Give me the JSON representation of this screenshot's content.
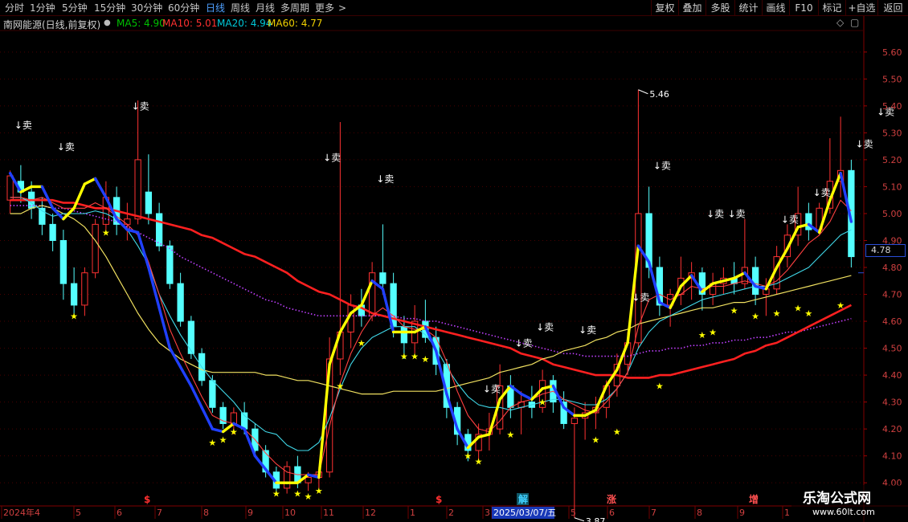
{
  "toolbar": {
    "periods": [
      "分时",
      "1分钟",
      "5分钟",
      "15分钟",
      "30分钟",
      "60分钟",
      "日线",
      "周线",
      "月线",
      "多周期",
      "更多"
    ],
    "active_period": "日线",
    "more_arrow": ">",
    "tools": [
      "复权",
      "叠加",
      "多股",
      "统计",
      "画线",
      "F10",
      "标记",
      "+自选",
      "返回"
    ]
  },
  "info": {
    "stock": "南网能源",
    "mode": "(日线,前复权)",
    "ma": [
      {
        "label": "MA5: 4.90",
        "color": "#00c000"
      },
      {
        "label": "MA10: 5.01",
        "color": "#ff3030"
      },
      {
        "label": "MA20: 4.94",
        "color": "#00c8d8"
      },
      {
        "label": "MA60: 4.77",
        "color": "#f0d000"
      }
    ]
  },
  "current_price": "4.78",
  "watermark": {
    "title": "乐淘公式网",
    "url": "www.60lt.com"
  },
  "chart_data": {
    "type": "candlestick",
    "y_axis": {
      "range": [
        3.92,
        5.68
      ],
      "ticks": [
        "5.60",
        "5.50",
        "5.40",
        "5.30",
        "5.20",
        "5.10",
        "5.00",
        "4.90",
        "4.80",
        "4.70",
        "4.60",
        "4.50",
        "4.40",
        "4.30",
        "4.20",
        "4.10",
        "4.00"
      ]
    },
    "x_axis": {
      "labels": [
        "2024年4",
        "5",
        "6",
        "7",
        "8",
        "9",
        "10",
        "11",
        "12",
        "1",
        "2",
        "3",
        "2025/03/07/五",
        "5",
        "6",
        "7",
        "8",
        "9",
        "1"
      ],
      "highlight_label": "2025/03/07/五",
      "event_marks": [
        {
          "text": "$",
          "color": "#ff3030"
        },
        {
          "text": "$",
          "color": "#ff3030"
        },
        {
          "text": "解",
          "color": "#40d0ff"
        },
        {
          "text": "涨",
          "color": "#ff5050"
        },
        {
          "text": "增",
          "color": "#ff5050"
        }
      ]
    },
    "annotations": {
      "high": "5.46",
      "low": "3.87",
      "sell_label": "↓卖",
      "star": "★"
    },
    "series": [
      {
        "name": "MA5",
        "color": "#00c000"
      },
      {
        "name": "MA10",
        "color": "#ff3030"
      },
      {
        "name": "MA20",
        "color": "#00c8d8"
      },
      {
        "name": "MA60",
        "color": "#f0d000"
      }
    ],
    "bias_line": [
      5.15,
      5.08,
      5.1,
      5.1,
      5.02,
      4.98,
      5.02,
      5.11,
      5.13,
      5.06,
      4.98,
      4.94,
      4.93,
      4.8,
      4.65,
      4.5,
      4.43,
      4.36,
      4.28,
      4.2,
      4.19,
      4.22,
      4.2,
      4.1,
      4.05,
      4.0,
      4.0,
      4.0,
      4.03,
      4.02,
      4.44,
      4.56,
      4.63,
      4.66,
      4.75,
      4.72,
      4.56,
      4.56,
      4.56,
      4.58,
      4.49,
      4.33,
      4.2,
      4.13,
      4.17,
      4.18,
      4.31,
      4.36,
      4.33,
      4.31,
      4.35,
      4.36,
      4.28,
      4.25,
      4.25,
      4.27,
      4.36,
      4.42,
      4.52,
      4.88,
      4.82,
      4.67,
      4.65,
      4.73,
      4.77,
      4.71,
      4.74,
      4.75,
      4.76,
      4.78,
      4.73,
      4.72,
      4.8,
      4.87,
      4.95,
      4.96,
      4.93,
      5.05,
      5.15,
      4.97
    ],
    "ma10_line": [
      5.06,
      5.06,
      5.05,
      5.06,
      5.04,
      5.02,
      5.02,
      5.02,
      5.04,
      5.02,
      4.99,
      4.96,
      4.92,
      4.82,
      4.7,
      4.57,
      4.48,
      4.4,
      4.32,
      4.25,
      4.23,
      4.22,
      4.2,
      4.16,
      4.11,
      4.07,
      4.04,
      4.03,
      4.03,
      4.03,
      4.21,
      4.37,
      4.48,
      4.56,
      4.62,
      4.65,
      4.62,
      4.58,
      4.57,
      4.57,
      4.54,
      4.45,
      4.34,
      4.25,
      4.2,
      4.19,
      4.23,
      4.28,
      4.3,
      4.31,
      4.33,
      4.34,
      4.31,
      4.29,
      4.27,
      4.26,
      4.3,
      4.35,
      4.41,
      4.58,
      4.68,
      4.7,
      4.68,
      4.7,
      4.73,
      4.72,
      4.73,
      4.73,
      4.74,
      4.75,
      4.74,
      4.73,
      4.75,
      4.79,
      4.84,
      4.89,
      4.92,
      4.97,
      5.05,
      5.01
    ],
    "ma20_line": [
      5.06,
      5.06,
      5.04,
      5.01,
      4.99,
      5.0,
      5.0,
      5.0,
      5.01,
      5.0,
      4.98,
      4.94,
      4.88,
      4.81,
      4.7,
      4.62,
      4.55,
      4.49,
      4.43,
      4.38,
      4.34,
      4.3,
      4.25,
      4.22,
      4.19,
      4.18,
      4.14,
      4.12,
      4.12,
      4.15,
      4.24,
      4.35,
      4.44,
      4.5,
      4.54,
      4.56,
      4.58,
      4.58,
      4.58,
      4.55,
      4.5,
      4.43,
      4.37,
      4.32,
      4.29,
      4.28,
      4.28,
      4.27,
      4.28,
      4.29,
      4.3,
      4.31,
      4.31,
      4.3,
      4.29,
      4.29,
      4.31,
      4.35,
      4.41,
      4.5,
      4.56,
      4.6,
      4.62,
      4.64,
      4.66,
      4.68,
      4.69,
      4.7,
      4.71,
      4.72,
      4.73,
      4.73,
      4.74,
      4.76,
      4.78,
      4.8,
      4.84,
      4.88,
      4.92,
      4.94
    ],
    "ma60_line": [
      5.0,
      5.0,
      5.02,
      5.03,
      5.02,
      5.0,
      4.98,
      4.95,
      4.9,
      4.84,
      4.77,
      4.7,
      4.63,
      4.57,
      4.52,
      4.49,
      4.46,
      4.44,
      4.42,
      4.41,
      4.41,
      4.41,
      4.41,
      4.41,
      4.4,
      4.4,
      4.39,
      4.38,
      4.38,
      4.37,
      4.36,
      4.35,
      4.34,
      4.33,
      4.33,
      4.33,
      4.34,
      4.34,
      4.34,
      4.34,
      4.34,
      4.35,
      4.36,
      4.37,
      4.38,
      4.39,
      4.41,
      4.42,
      4.43,
      4.44,
      4.46,
      4.47,
      4.49,
      4.5,
      4.51,
      4.53,
      4.54,
      4.56,
      4.57,
      4.59,
      4.6,
      4.61,
      4.62,
      4.63,
      4.64,
      4.65,
      4.65,
      4.66,
      4.67,
      4.67,
      4.68,
      4.69,
      4.7,
      4.71,
      4.72,
      4.73,
      4.74,
      4.75,
      4.76,
      4.77
    ],
    "ma120_line": [
      5.05,
      5.05,
      5.05,
      5.05,
      5.05,
      5.04,
      5.04,
      5.03,
      5.02,
      5.02,
      5.01,
      5.0,
      4.99,
      4.98,
      4.97,
      4.96,
      4.95,
      4.94,
      4.92,
      4.91,
      4.89,
      4.87,
      4.85,
      4.84,
      4.82,
      4.8,
      4.78,
      4.75,
      4.73,
      4.71,
      4.7,
      4.68,
      4.66,
      4.65,
      4.63,
      4.62,
      4.61,
      4.6,
      4.59,
      4.58,
      4.57,
      4.56,
      4.55,
      4.54,
      4.53,
      4.52,
      4.51,
      4.5,
      4.48,
      4.47,
      4.46,
      4.44,
      4.43,
      4.42,
      4.41,
      4.4,
      4.4,
      4.4,
      4.39,
      4.39,
      4.39,
      4.4,
      4.4,
      4.41,
      4.42,
      4.43,
      4.44,
      4.45,
      4.46,
      4.48,
      4.49,
      4.51,
      4.52,
      4.54,
      4.56,
      4.58,
      4.6,
      4.62,
      4.64,
      4.66
    ],
    "purple_line": [
      5.03,
      5.03,
      5.03,
      5.03,
      5.02,
      5.02,
      5.01,
      5.0,
      4.99,
      4.98,
      4.97,
      4.95,
      4.93,
      4.91,
      4.89,
      4.87,
      4.84,
      4.82,
      4.8,
      4.78,
      4.76,
      4.74,
      4.72,
      4.7,
      4.68,
      4.67,
      4.65,
      4.64,
      4.63,
      4.62,
      4.62,
      4.62,
      4.62,
      4.62,
      4.62,
      4.62,
      4.62,
      4.61,
      4.61,
      4.6,
      4.6,
      4.59,
      4.58,
      4.57,
      4.56,
      4.55,
      4.54,
      4.53,
      4.52,
      4.51,
      4.5,
      4.49,
      4.48,
      4.48,
      4.47,
      4.47,
      4.47,
      4.47,
      4.47,
      4.48,
      4.49,
      4.49,
      4.5,
      4.5,
      4.51,
      4.51,
      4.52,
      4.52,
      4.53,
      4.53,
      4.54,
      4.54,
      4.55,
      4.56,
      4.56,
      4.57,
      4.58,
      4.59,
      4.6,
      4.61
    ],
    "candles": [
      [
        5.05,
        5.16,
        5.0,
        5.14
      ],
      [
        5.12,
        5.18,
        5.04,
        5.08
      ],
      [
        5.08,
        5.12,
        4.98,
        5.02
      ],
      [
        5.02,
        5.06,
        4.92,
        4.96
      ],
      [
        4.96,
        5.0,
        4.86,
        4.9
      ],
      [
        4.9,
        4.94,
        4.68,
        4.74
      ],
      [
        4.74,
        4.8,
        4.62,
        4.66
      ],
      [
        4.66,
        4.8,
        4.62,
        4.78
      ],
      [
        4.78,
        4.98,
        4.76,
        4.96
      ],
      [
        4.96,
        5.12,
        4.94,
        5.06
      ],
      [
        5.06,
        5.1,
        4.92,
        4.96
      ],
      [
        4.96,
        5.04,
        4.9,
        4.98
      ],
      [
        4.98,
        5.42,
        4.96,
        5.2
      ],
      [
        5.08,
        5.22,
        4.96,
        5.0
      ],
      [
        5.0,
        5.04,
        4.86,
        4.88
      ],
      [
        4.88,
        4.9,
        4.72,
        4.74
      ],
      [
        4.74,
        4.78,
        4.58,
        4.6
      ],
      [
        4.6,
        4.62,
        4.46,
        4.48
      ],
      [
        4.48,
        4.5,
        4.36,
        4.38
      ],
      [
        4.38,
        4.4,
        4.26,
        4.28
      ],
      [
        4.28,
        4.3,
        4.2,
        4.22
      ],
      [
        4.22,
        4.28,
        4.18,
        4.26
      ],
      [
        4.26,
        4.3,
        4.18,
        4.2
      ],
      [
        4.2,
        4.22,
        4.1,
        4.12
      ],
      [
        4.12,
        4.14,
        4.02,
        4.04
      ],
      [
        4.04,
        4.06,
        3.96,
        3.98
      ],
      [
        3.98,
        4.08,
        3.96,
        4.06
      ],
      [
        4.06,
        4.1,
        3.98,
        4.0
      ],
      [
        4.0,
        4.04,
        3.97,
        4.02
      ],
      [
        4.02,
        4.06,
        3.98,
        4.04
      ],
      [
        4.04,
        4.54,
        4.02,
        4.46
      ],
      [
        4.46,
        5.34,
        4.4,
        4.56
      ],
      [
        4.56,
        4.7,
        4.5,
        4.66
      ],
      [
        4.66,
        4.72,
        4.58,
        4.62
      ],
      [
        4.62,
        4.82,
        4.6,
        4.78
      ],
      [
        4.78,
        4.96,
        4.7,
        4.74
      ],
      [
        4.74,
        4.78,
        4.54,
        4.58
      ],
      [
        4.58,
        4.62,
        4.46,
        4.52
      ],
      [
        4.52,
        4.66,
        4.48,
        4.6
      ],
      [
        4.6,
        4.68,
        4.52,
        4.54
      ],
      [
        4.54,
        4.58,
        4.4,
        4.44
      ],
      [
        4.44,
        4.46,
        4.24,
        4.28
      ],
      [
        4.28,
        4.3,
        4.14,
        4.18
      ],
      [
        4.18,
        4.2,
        4.08,
        4.12
      ],
      [
        4.12,
        4.22,
        4.08,
        4.18
      ],
      [
        4.18,
        4.26,
        4.12,
        4.2
      ],
      [
        4.2,
        4.44,
        4.18,
        4.36
      ],
      [
        4.36,
        4.4,
        4.24,
        4.28
      ],
      [
        4.28,
        4.34,
        4.18,
        4.3
      ],
      [
        4.3,
        4.36,
        4.24,
        4.28
      ],
      [
        4.28,
        4.42,
        4.26,
        4.38
      ],
      [
        4.38,
        4.4,
        4.26,
        4.3
      ],
      [
        4.3,
        4.34,
        4.2,
        4.22
      ],
      [
        4.22,
        4.28,
        3.87,
        4.24
      ],
      [
        4.24,
        4.3,
        4.16,
        4.26
      ],
      [
        4.26,
        4.32,
        4.2,
        4.28
      ],
      [
        4.28,
        4.38,
        4.24,
        4.36
      ],
      [
        4.36,
        4.48,
        4.32,
        4.44
      ],
      [
        4.44,
        4.56,
        4.4,
        4.52
      ],
      [
        4.52,
        5.46,
        4.5,
        5.0
      ],
      [
        5.0,
        5.1,
        4.76,
        4.8
      ],
      [
        4.8,
        4.84,
        4.62,
        4.66
      ],
      [
        4.66,
        4.72,
        4.58,
        4.7
      ],
      [
        4.7,
        4.84,
        4.66,
        4.76
      ],
      [
        4.76,
        4.82,
        4.68,
        4.78
      ],
      [
        4.78,
        4.8,
        4.64,
        4.7
      ],
      [
        4.7,
        4.78,
        4.66,
        4.74
      ],
      [
        4.74,
        4.8,
        4.7,
        4.76
      ],
      [
        4.76,
        4.82,
        4.7,
        4.74
      ],
      [
        4.74,
        4.98,
        4.72,
        4.8
      ],
      [
        4.8,
        4.84,
        4.66,
        4.7
      ],
      [
        4.7,
        4.76,
        4.62,
        4.72
      ],
      [
        4.72,
        4.88,
        4.7,
        4.84
      ],
      [
        4.84,
        4.96,
        4.8,
        4.92
      ],
      [
        4.92,
        5.1,
        4.88,
        5.0
      ],
      [
        5.0,
        5.04,
        4.9,
        4.94
      ],
      [
        4.94,
        5.04,
        4.92,
        5.02
      ],
      [
        5.02,
        5.28,
        5.0,
        5.12
      ],
      [
        5.12,
        5.36,
        5.06,
        5.16
      ],
      [
        5.16,
        5.2,
        4.8,
        4.84
      ]
    ],
    "sell_signals": [
      {
        "bar": 1,
        "price": 5.31
      },
      {
        "bar": 5,
        "price": 5.23
      },
      {
        "bar": 12,
        "price": 5.38
      },
      {
        "bar": 30,
        "price": 5.19
      },
      {
        "bar": 35,
        "price": 5.11
      },
      {
        "bar": 48,
        "price": 4.5
      },
      {
        "bar": 50,
        "price": 4.56
      },
      {
        "bar": 54,
        "price": 4.55
      },
      {
        "bar": 45,
        "price": 4.33
      },
      {
        "bar": 59,
        "price": 4.67
      },
      {
        "bar": 61,
        "price": 5.16
      },
      {
        "bar": 66,
        "price": 4.98
      },
      {
        "bar": 68,
        "price": 4.98
      },
      {
        "bar": 73,
        "price": 4.96
      },
      {
        "bar": 76,
        "price": 5.06
      },
      {
        "bar": 80,
        "price": 5.24
      },
      {
        "bar": 82,
        "price": 5.36
      }
    ],
    "star_signals": [
      {
        "bar": 6,
        "price": 4.62
      },
      {
        "bar": 9,
        "price": 4.93
      },
      {
        "bar": 19,
        "price": 4.15
      },
      {
        "bar": 20,
        "price": 4.16
      },
      {
        "bar": 21,
        "price": 4.19
      },
      {
        "bar": 25,
        "price": 3.96
      },
      {
        "bar": 27,
        "price": 3.96
      },
      {
        "bar": 28,
        "price": 3.95
      },
      {
        "bar": 29,
        "price": 3.97
      },
      {
        "bar": 31,
        "price": 4.36
      },
      {
        "bar": 33,
        "price": 4.52
      },
      {
        "bar": 37,
        "price": 4.47
      },
      {
        "bar": 38,
        "price": 4.47
      },
      {
        "bar": 39,
        "price": 4.46
      },
      {
        "bar": 43,
        "price": 4.1
      },
      {
        "bar": 44,
        "price": 4.08
      },
      {
        "bar": 47,
        "price": 4.18
      },
      {
        "bar": 50,
        "price": 4.3
      },
      {
        "bar": 55,
        "price": 4.16
      },
      {
        "bar": 57,
        "price": 4.19
      },
      {
        "bar": 61,
        "price": 4.36
      },
      {
        "bar": 65,
        "price": 4.55
      },
      {
        "bar": 66,
        "price": 4.56
      },
      {
        "bar": 68,
        "price": 4.64
      },
      {
        "bar": 70,
        "price": 4.62
      },
      {
        "bar": 72,
        "price": 4.63
      },
      {
        "bar": 74,
        "price": 4.65
      },
      {
        "bar": 75,
        "price": 4.63
      },
      {
        "bar": 78,
        "price": 4.66
      },
      {
        "bar": 81,
        "price": 4.86
      }
    ]
  }
}
